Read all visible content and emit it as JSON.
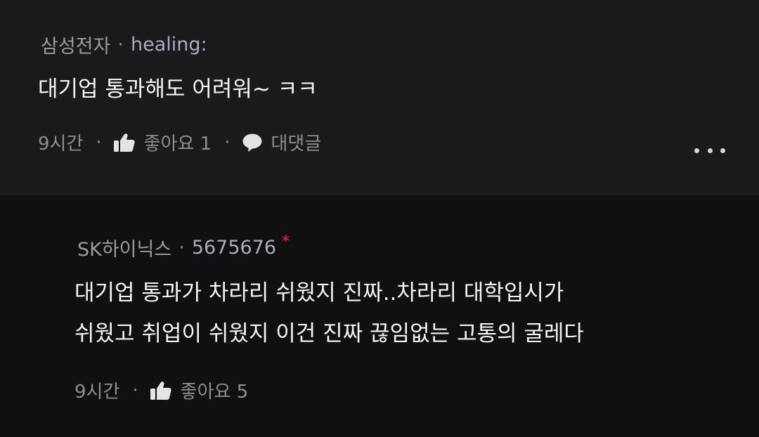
{
  "comments": [
    {
      "company": "삼성전자",
      "separator": "·",
      "nickname": "healing:",
      "text_lines": [
        "대기업 통과해도 어려워~ ㅋㅋ"
      ],
      "time": "9시간",
      "like_label": "좋아요 1",
      "reply_label": "대댓글"
    },
    {
      "company": "SK하이닉스",
      "separator": "·",
      "nickname": "5675676",
      "author_marker": "*",
      "text_lines": [
        "대기업 통과가 차라리 쉬웠지 진짜..차라리 대학입시가",
        "쉬웠고 취업이 쉬웠지 이건 진짜 끊임없는 고통의 굴레다"
      ],
      "time": "9시간",
      "like_label": "좋아요 5"
    }
  ],
  "footer_separator": "·",
  "icons": {
    "like": "thumbs-up-icon",
    "reply": "speech-bubble-icon",
    "more": "more-dots-icon"
  },
  "colors": {
    "background_top": "#1a1a1c",
    "background_reply": "#101012",
    "body_text": "#f4f4f6",
    "meta_text": "#9a9aa0",
    "author_marker": "#e0343a"
  }
}
